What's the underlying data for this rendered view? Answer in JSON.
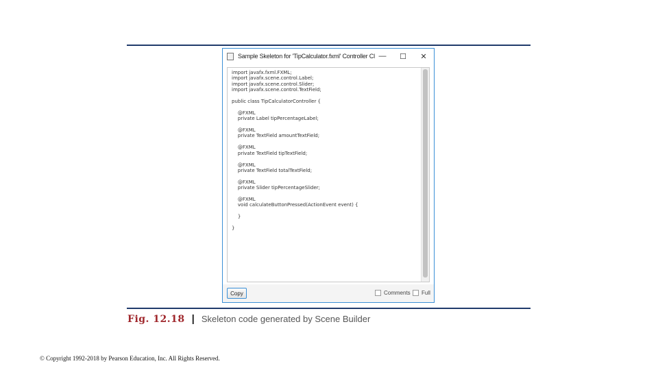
{
  "window": {
    "title": "Sample Skeleton for 'TipCalculator.fxml' Controller Class",
    "minimize": "—",
    "maximize": "☐",
    "close": "✕"
  },
  "code": {
    "text": "import javafx.fxml.FXML;\nimport javafx.scene.control.Label;\nimport javafx.scene.control.Slider;\nimport javafx.scene.control.TextField;\n\npublic class TipCalculatorController {\n\n    @FXML\n    private Label tipPercentageLabel;\n\n    @FXML\n    private TextField amountTextField;\n\n    @FXML\n    private TextField tipTextField;\n\n    @FXML\n    private TextField totalTextField;\n\n    @FXML\n    private Slider tipPercentageSlider;\n\n    @FXML\n    void calculateButtonPressed(ActionEvent event) {\n\n    }\n\n}"
  },
  "footer": {
    "copy_label": "Copy",
    "comments_label": "Comments",
    "comments_checked": false,
    "full_label": "Full",
    "full_checked": false
  },
  "caption": {
    "figure": "Fig. 12.18",
    "separator": "|",
    "text": "Skeleton code generated by Scene Builder"
  },
  "copyright": "© Copyright 1992-2018 by Pearson Education, Inc. All Rights Reserved.",
  "colors": {
    "rule": "#1f3a6b",
    "figure_label": "#a0282d",
    "window_border": "#3a8fd6"
  }
}
